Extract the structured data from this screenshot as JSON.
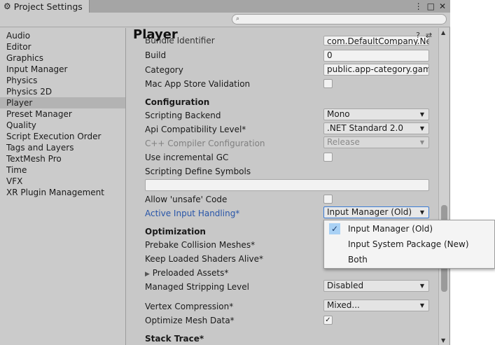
{
  "window": {
    "tab_title": "Project Settings",
    "search_placeholder": "⌕"
  },
  "sidebar": {
    "items": [
      {
        "label": "Audio"
      },
      {
        "label": "Editor"
      },
      {
        "label": "Graphics"
      },
      {
        "label": "Input Manager"
      },
      {
        "label": "Physics"
      },
      {
        "label": "Physics 2D"
      },
      {
        "label": "Player"
      },
      {
        "label": "Preset Manager"
      },
      {
        "label": "Quality"
      },
      {
        "label": "Script Execution Order"
      },
      {
        "label": "Tags and Layers"
      },
      {
        "label": "TextMesh Pro"
      },
      {
        "label": "Time"
      },
      {
        "label": "VFX"
      },
      {
        "label": "XR Plugin Management"
      }
    ],
    "selected": "Player"
  },
  "main": {
    "title": "Player",
    "bundle_identifier_label": "Bundle Identifier",
    "bundle_identifier_value": "com.DefaultCompany.New",
    "build_label": "Build",
    "build_value": "0",
    "category_label": "Category",
    "category_value": "public.app-category.game",
    "mas_validation_label": "Mac App Store Validation",
    "configuration_header": "Configuration",
    "scripting_backend_label": "Scripting Backend",
    "scripting_backend_value": "Mono",
    "api_compat_label": "Api Compatibility Level*",
    "api_compat_value": ".NET Standard 2.0",
    "cpp_compiler_label": "C++ Compiler Configuration",
    "cpp_compiler_value": "Release",
    "incremental_gc_label": "Use incremental GC",
    "define_symbols_label": "Scripting Define Symbols",
    "define_symbols_value": "",
    "unsafe_code_label": "Allow 'unsafe' Code",
    "active_input_label": "Active Input Handling*",
    "active_input_value": "Input Manager (Old)",
    "optimization_header": "Optimization",
    "prebake_label": "Prebake Collision Meshes*",
    "keep_shaders_label": "Keep Loaded Shaders Alive*",
    "preloaded_assets_label": "Preloaded Assets*",
    "stripping_label": "Managed Stripping Level",
    "stripping_value": "Disabled",
    "vertex_compression_label": "Vertex Compression*",
    "vertex_compression_value": "Mixed...",
    "optimize_mesh_label": "Optimize Mesh Data*",
    "stack_trace_header": "Stack Trace*",
    "check_mark": "✓",
    "expand_arrow": "▶",
    "dropdown_arrow": "▼"
  },
  "popup": {
    "items": [
      {
        "label": "Input Manager (Old)",
        "checked": true
      },
      {
        "label": "Input System Package (New)",
        "checked": false
      },
      {
        "label": "Both",
        "checked": false
      }
    ]
  },
  "icons": {
    "gear": "⚙",
    "menu_dots": "⋮",
    "maximize": "□",
    "close": "✕",
    "help": "?",
    "presets": "⇄",
    "settings": "⚙",
    "scroll_up": "▲",
    "scroll_down": "▼"
  },
  "colors": {
    "selected_item_bg": "#b3b3b3",
    "link_blue": "#2855a8",
    "check_highlight": "#a9d1f5"
  }
}
